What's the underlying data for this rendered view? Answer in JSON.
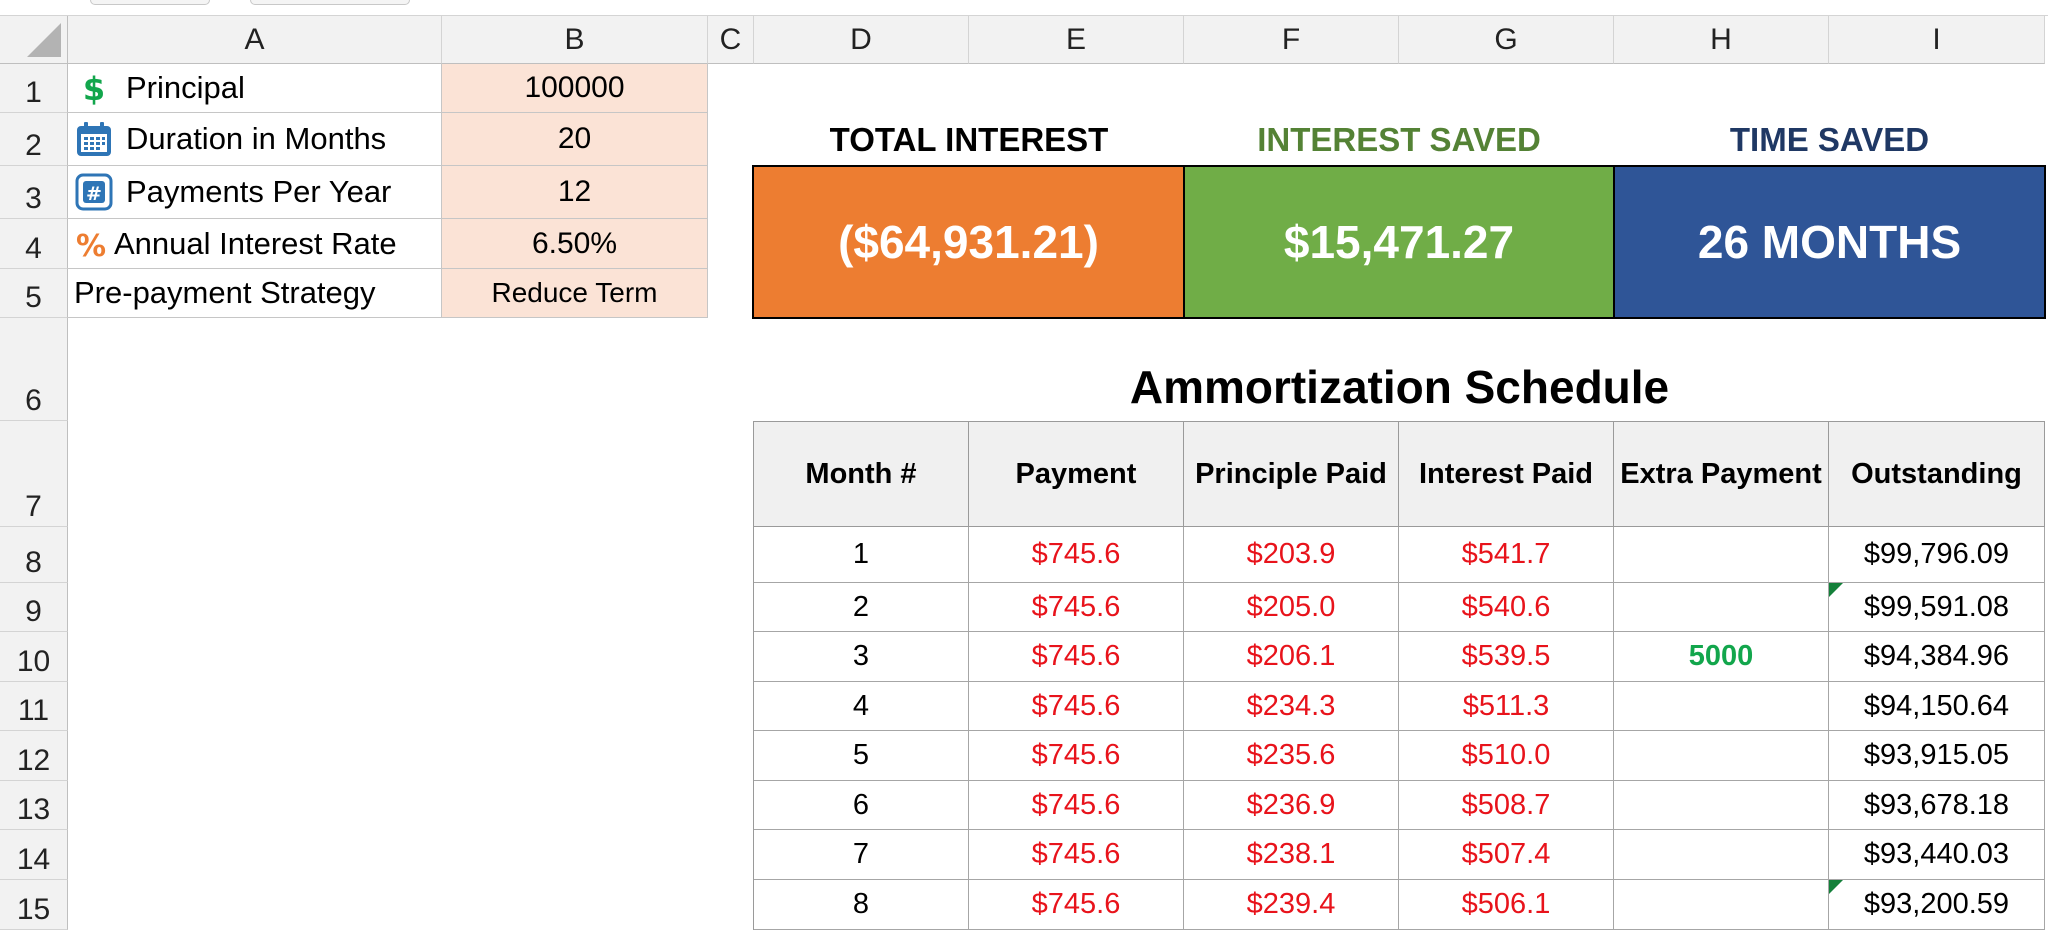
{
  "columns": [
    "A",
    "B",
    "C",
    "D",
    "E",
    "F",
    "G",
    "H",
    "I"
  ],
  "rows": [
    "1",
    "2",
    "3",
    "4",
    "5",
    "6",
    "7",
    "8",
    "9",
    "10",
    "11",
    "12",
    "13",
    "14",
    "15"
  ],
  "inputs": [
    {
      "icon": "dollar-icon",
      "label": "Principal",
      "value": "100000"
    },
    {
      "icon": "calendar-icon",
      "label": "Duration in Months",
      "value": "20"
    },
    {
      "icon": "hash-icon",
      "label": "Payments Per Year",
      "value": "12"
    },
    {
      "icon": "percent-icon",
      "label": "Annual Interest Rate",
      "value": "6.50%"
    },
    {
      "icon": "",
      "label": "Pre-payment Strategy",
      "value": "Reduce Term"
    }
  ],
  "kpis": [
    {
      "title": "TOTAL INTEREST",
      "value": "($64,931.21)",
      "title_color": "#000000",
      "bg": "#ed7d31"
    },
    {
      "title": "INTEREST SAVED",
      "value": "$15,471.27",
      "title_color": "#548235",
      "bg": "#70ad47"
    },
    {
      "title": "TIME SAVED",
      "value": "26 MONTHS",
      "title_color": "#1f3864",
      "bg": "#2f5597"
    }
  ],
  "schedule": {
    "title": "Ammortization Schedule",
    "headers": [
      "Month #",
      "Payment",
      "Principle Paid",
      "Interest Paid",
      "Extra Payment",
      "Outstanding"
    ],
    "rows": [
      {
        "month": "1",
        "payment": "$745.6",
        "principal": "$203.9",
        "interest": "$541.7",
        "extra": "",
        "outstanding": "$99,796.09"
      },
      {
        "month": "2",
        "payment": "$745.6",
        "principal": "$205.0",
        "interest": "$540.6",
        "extra": "",
        "outstanding": "$99,591.08"
      },
      {
        "month": "3",
        "payment": "$745.6",
        "principal": "$206.1",
        "interest": "$539.5",
        "extra": "5000",
        "outstanding": "$94,384.96"
      },
      {
        "month": "4",
        "payment": "$745.6",
        "principal": "$234.3",
        "interest": "$511.3",
        "extra": "",
        "outstanding": "$94,150.64"
      },
      {
        "month": "5",
        "payment": "$745.6",
        "principal": "$235.6",
        "interest": "$510.0",
        "extra": "",
        "outstanding": "$93,915.05"
      },
      {
        "month": "6",
        "payment": "$745.6",
        "principal": "$236.9",
        "interest": "$508.7",
        "extra": "",
        "outstanding": "$93,678.18"
      },
      {
        "month": "7",
        "payment": "$745.6",
        "principal": "$238.1",
        "interest": "$507.4",
        "extra": "",
        "outstanding": "$93,440.03"
      },
      {
        "month": "8",
        "payment": "$745.6",
        "principal": "$239.4",
        "interest": "$506.1",
        "extra": "",
        "outstanding": "$93,200.59"
      }
    ]
  },
  "colors": {
    "red_text": "#e8131b",
    "extra_green": "#12a64c",
    "input_fill": "#fbe3d6"
  }
}
